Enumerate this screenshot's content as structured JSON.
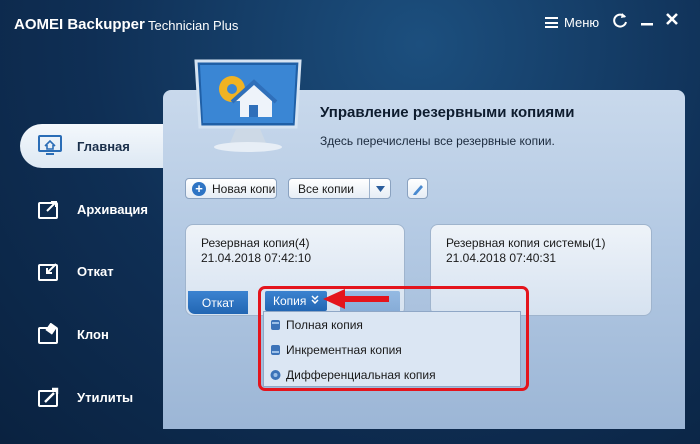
{
  "titlebar": {
    "app_name": "AOMEI Backupper",
    "edition": "Technician Plus",
    "menu_label": "Меню",
    "icons": [
      "menu-icon",
      "refresh-icon",
      "minimize-icon",
      "close-icon"
    ]
  },
  "sidebar": {
    "items": [
      {
        "label": "Главная",
        "icon": "home-monitor-icon",
        "active": true
      },
      {
        "label": "Архивация",
        "icon": "backup-icon"
      },
      {
        "label": "Откат",
        "icon": "restore-icon"
      },
      {
        "label": "Клон",
        "icon": "clone-icon"
      },
      {
        "label": "Утилиты",
        "icon": "tools-icon"
      }
    ]
  },
  "header": {
    "title": "Управление резервными копиями",
    "description": "Здесь перечислены все резервные копии."
  },
  "toolbar": {
    "new_label": "Новая копи",
    "filter_value": "Все копии",
    "icon": "edit-icon"
  },
  "cards": [
    {
      "title": "Резервная копия(4)",
      "date": "21.04.2018 07:42:10",
      "restore_label": "Откат",
      "copy_label": "Копия"
    },
    {
      "title": "Резервная копия системы(1)",
      "date": "21.04.2018 07:40:31"
    }
  ],
  "dropdown": {
    "items": [
      "Полная копия",
      "Инкрементная копия",
      "Дифференциальная копия"
    ]
  },
  "colors": {
    "accent": "#2e74c4",
    "annotation": "#e4141c",
    "background": "#0f2f55"
  }
}
